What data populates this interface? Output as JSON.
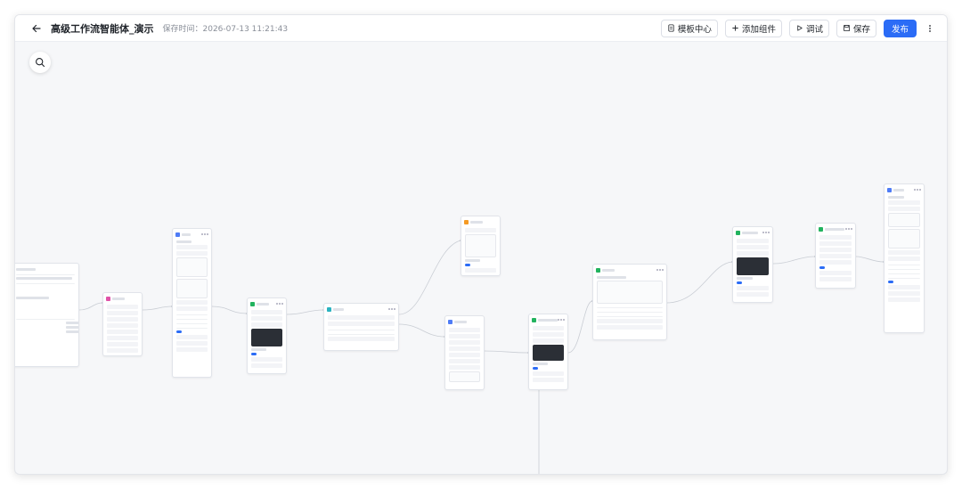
{
  "header": {
    "title": "高级工作流智能体_演示",
    "save_time": "保存时间：2026-07-13 11:21:43",
    "buttons": {
      "template_center": "模板中心",
      "add_component": "添加组件",
      "debug": "调试",
      "save": "保存",
      "publish": "发布"
    }
  },
  "colors": {
    "accent": "#2b6cf6",
    "node_green": "#22b35e",
    "node_blue": "#4f7cf6",
    "node_purple": "#9b5cf6",
    "node_orange": "#f59a23",
    "node_pink": "#e052a8",
    "node_teal": "#2bb3c0"
  },
  "icons": {
    "back": "arrow-left-icon",
    "search": "search-icon",
    "template": "document-icon",
    "add": "plus-icon",
    "debug": "play-icon",
    "save": "floppy-icon",
    "more": "more-vertical-icon"
  }
}
